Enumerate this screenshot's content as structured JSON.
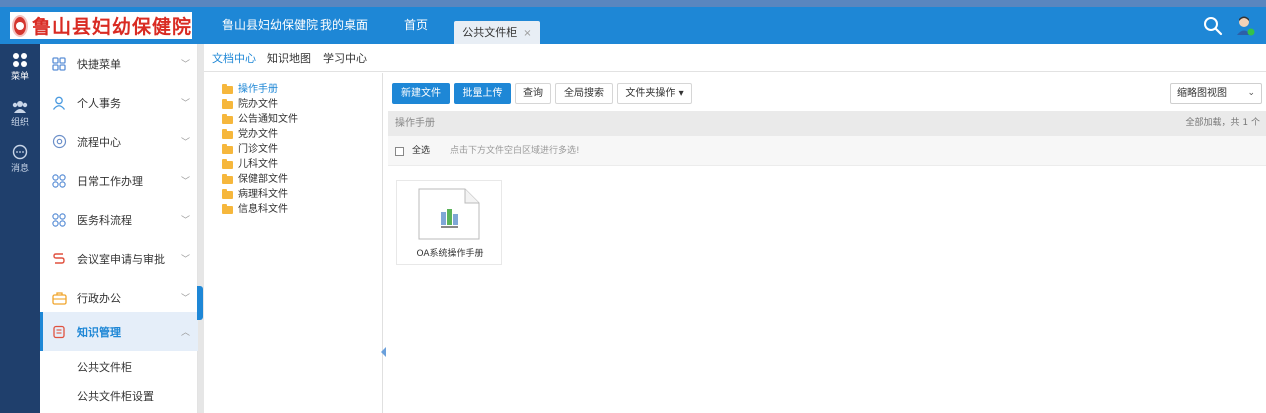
{
  "app": {
    "logo_text": "鲁山县妇幼保健院"
  },
  "header": {
    "nav": [
      "鲁山县妇幼保健院",
      "我的桌面",
      "首页"
    ],
    "active_tab": "公共文件柜",
    "active_tab_close": "×"
  },
  "rail": [
    {
      "label": "菜单",
      "icon": "grid-icon"
    },
    {
      "label": "组织",
      "icon": "people-icon"
    },
    {
      "label": "消息",
      "icon": "chat-icon"
    }
  ],
  "sidebar": {
    "items": [
      {
        "label": "快捷菜单",
        "icon": "shortcut-icon"
      },
      {
        "label": "个人事务",
        "icon": "person-icon"
      },
      {
        "label": "流程中心",
        "icon": "workflow-icon"
      },
      {
        "label": "日常工作办理",
        "icon": "grid-icon"
      },
      {
        "label": "医务科流程",
        "icon": "grid-icon"
      },
      {
        "label": "会议室申请与审批",
        "icon": "meeting-icon"
      },
      {
        "label": "行政办公",
        "icon": "briefcase-icon"
      },
      {
        "label": "知识管理",
        "icon": "book-icon"
      }
    ],
    "sub_items": [
      "公共文件柜",
      "公共文件柜设置"
    ]
  },
  "subnav": [
    "文档中心",
    "知识地图",
    "学习中心"
  ],
  "tree": [
    "操作手册",
    "院办文件",
    "公告通知文件",
    "党办文件",
    "门诊文件",
    "儿科文件",
    "保健部文件",
    "病理科文件",
    "信息科文件"
  ],
  "toolbar": {
    "new_file": "新建文件",
    "batch_upload": "批量上传",
    "query": "查询",
    "global_search": "全局搜索",
    "folder_ops": "文件夹操作",
    "view_mode": "缩略图视图"
  },
  "pathbar": {
    "current": "操作手册",
    "summary": "全部加载，共 1 个"
  },
  "selectbar": {
    "select_all": "全选",
    "hint": "点击下方文件空白区域进行多选!"
  },
  "files": [
    {
      "name": "OA系统操作手册"
    }
  ],
  "colors": {
    "header": "#1e87d6",
    "rail": "#1f3f6c",
    "accent": "#1e87d6",
    "folder": "#f6b73c"
  }
}
